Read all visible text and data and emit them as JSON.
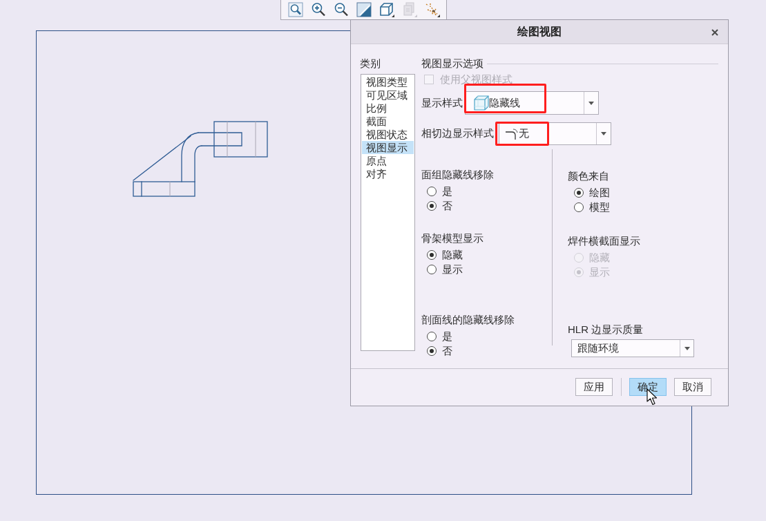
{
  "toolbar": {
    "buttons": [
      {
        "disabled": false
      },
      {
        "disabled": false
      },
      {
        "disabled": false
      },
      {
        "disabled": false
      },
      {
        "disabled": false
      },
      {
        "disabled": true
      },
      {
        "disabled": false
      }
    ]
  },
  "dialog": {
    "title": "绘图视图",
    "category_label": "类别",
    "categories": [
      {
        "label": "视图类型",
        "selected": false
      },
      {
        "label": "可见区域",
        "selected": false
      },
      {
        "label": "比例",
        "selected": false
      },
      {
        "label": "截面",
        "selected": false
      },
      {
        "label": "视图状态",
        "selected": false
      },
      {
        "label": "视图显示",
        "selected": true
      },
      {
        "label": "原点",
        "selected": false
      },
      {
        "label": "对齐",
        "selected": false
      }
    ],
    "section_title": "视图显示选项",
    "use_parent_style": {
      "label": "使用父视图样式",
      "checked": false,
      "disabled": true
    },
    "display_style": {
      "label": "显示样式",
      "value": "隐藏线",
      "marked": true
    },
    "tangent_edge_style": {
      "label": "相切边显示样式",
      "value": "无",
      "marked": true
    },
    "left_groups": [
      {
        "title": "面组隐藏线移除",
        "options": [
          {
            "label": "是",
            "selected": false,
            "disabled": false
          },
          {
            "label": "否",
            "selected": true,
            "disabled": false
          }
        ]
      },
      {
        "title": "骨架模型显示",
        "options": [
          {
            "label": "隐藏",
            "selected": true,
            "disabled": false
          },
          {
            "label": "显示",
            "selected": false,
            "disabled": false
          }
        ]
      },
      {
        "title": "剖面线的隐藏线移除",
        "options": [
          {
            "label": "是",
            "selected": false,
            "disabled": false
          },
          {
            "label": "否",
            "selected": true,
            "disabled": false
          }
        ]
      }
    ],
    "right_groups": [
      {
        "title": "颜色来自",
        "options": [
          {
            "label": "绘图",
            "selected": true,
            "disabled": false
          },
          {
            "label": "模型",
            "selected": false,
            "disabled": false
          }
        ]
      },
      {
        "title": "焊件横截面显示",
        "options": [
          {
            "label": "隐藏",
            "selected": false,
            "disabled": true
          },
          {
            "label": "显示",
            "selected": true,
            "disabled": true
          }
        ]
      }
    ],
    "hlr_quality": {
      "label": "HLR 边显示质量",
      "value": "跟随环境"
    },
    "buttons": [
      {
        "label": "应用",
        "highlighted": false
      },
      {
        "label": "确定",
        "highlighted": true
      },
      {
        "label": "取消",
        "highlighted": false
      }
    ]
  }
}
